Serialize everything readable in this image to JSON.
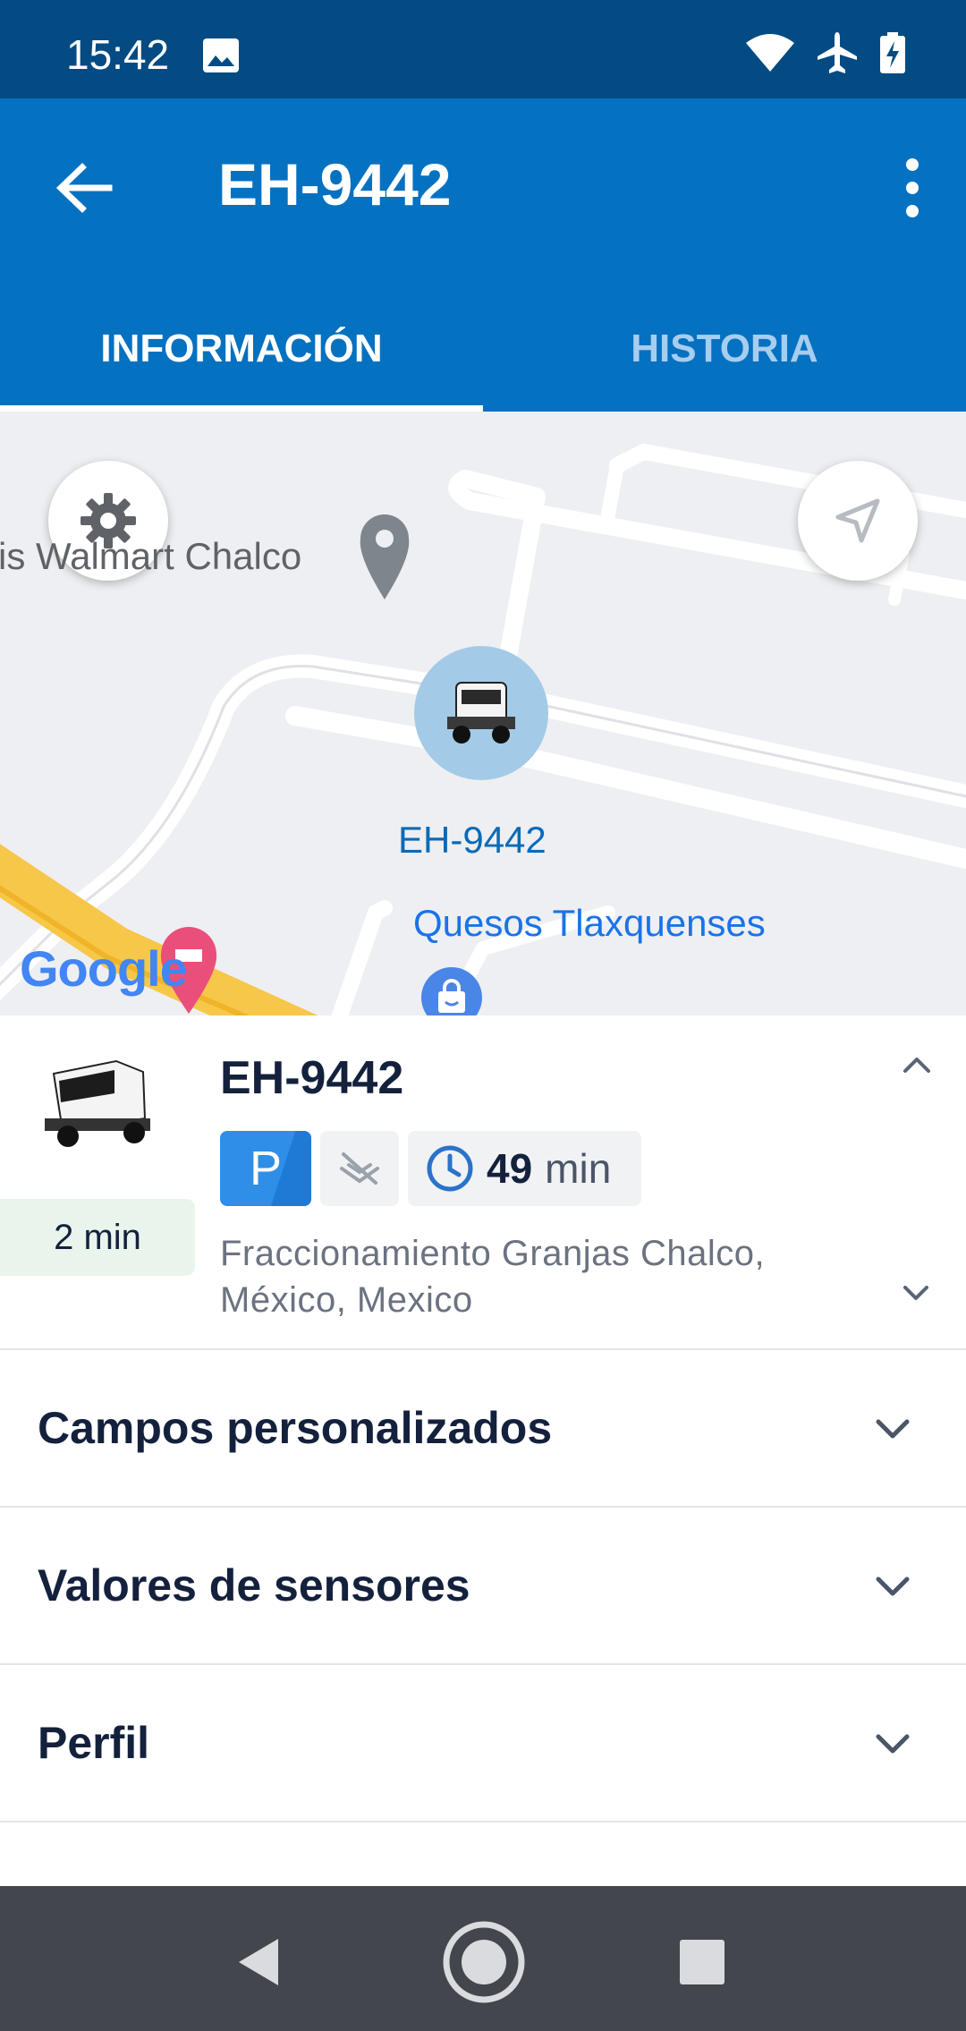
{
  "status_bar": {
    "time": "15:42",
    "icons": [
      "image-icon",
      "wifi-icon",
      "airplane-icon",
      "battery-charging-icon"
    ]
  },
  "app_bar": {
    "title": "EH-9442",
    "back_icon": "arrow-left-icon",
    "menu_icon": "more-vert-icon",
    "background": "#0571c1"
  },
  "tabs": [
    {
      "label": "INFORMACIÓN",
      "selected": true
    },
    {
      "label": "HISTORIA",
      "selected": false
    }
  ],
  "map": {
    "poi_walmart": "is Walmart Chalco",
    "poi_quesos": "Quesos Tlaxquenses",
    "vehicle_label": "EH-9442",
    "attribution": "Google",
    "settings_icon": "gear-icon",
    "locate_icon": "navigation-arrow-icon"
  },
  "vehicle_card": {
    "name": "EH-9442",
    "last_update": "2 min",
    "parking_badge": "P",
    "duration_value": "49",
    "duration_unit": "min",
    "address": "Fraccionamiento Granjas Chalco, México, Mexico",
    "accent": "#2f8ee8"
  },
  "sections": [
    {
      "title": "Campos personalizados"
    },
    {
      "title": "Valores de sensores"
    },
    {
      "title": "Perfil"
    }
  ]
}
